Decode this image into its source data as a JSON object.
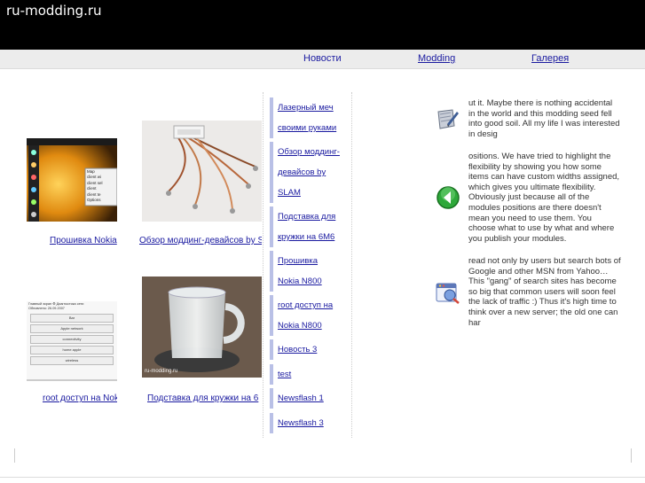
{
  "site": {
    "title": "ru-modding.ru"
  },
  "nav": {
    "items": [
      "Новости",
      "Modding",
      "Галерея"
    ]
  },
  "gallery": {
    "items": [
      {
        "caption": "Прошивка Nokia",
        "phone_menu": [
          "Map",
          "client wi",
          "client sel",
          "client",
          "client te",
          "Options"
        ]
      },
      {
        "caption": "Обзор моддинг-девайсов by S"
      },
      {
        "caption": "root доступ на Nok",
        "screen_title": "Главный экран ⚙ Диагностика сети",
        "screen_date": "Обновлено: 26.09.2007",
        "screen_rows": [
          "Bar",
          "Apple network",
          "connectivity",
          "home apple",
          "wireless"
        ]
      },
      {
        "caption": "Подставка для кружки на 6",
        "watermark": "ru-modding.ru"
      }
    ]
  },
  "news": {
    "items": [
      {
        "lines": [
          "Лазерный меч",
          "своими руками"
        ]
      },
      {
        "lines": [
          "Обзор моддинг-",
          "девайсов by",
          "SLAM"
        ]
      },
      {
        "lines": [
          "Подставка для",
          "кружки на 6М6"
        ]
      },
      {
        "lines": [
          "Прошивка",
          "Nokia N800"
        ]
      },
      {
        "lines": [
          "root доступ на",
          "Nokia N800"
        ]
      },
      {
        "lines": [
          "Новость 3"
        ]
      },
      {
        "lines": [
          "test"
        ]
      },
      {
        "lines": [
          "Newsflash 1"
        ]
      },
      {
        "lines": [
          "Newsflash 3"
        ]
      }
    ]
  },
  "modules": [
    {
      "icon": "edit-document-icon",
      "text": "ut it. Maybe there is nothing accidental in the world and this modding seed fell into good soil. All my life I was interested in desig"
    },
    {
      "icon": "green-back-arrow-icon",
      "text": "ositions. We have tried to highlight the flexibility by showing you how some items can have custom widths assigned, which gives you ultimate flexibility. Obviously just because all of the modules positions are there doesn't mean you need to use them. You choose what to use by what and where you publish your modules."
    },
    {
      "icon": "search-window-icon",
      "text": "read not only by users but search bots of Google and other MSN from Yahoo… This \"gang\" of search sites has become so big that common users will soon feel the lack of traffic :) Thus it's high time to think over a new server; the old one can har"
    }
  ]
}
